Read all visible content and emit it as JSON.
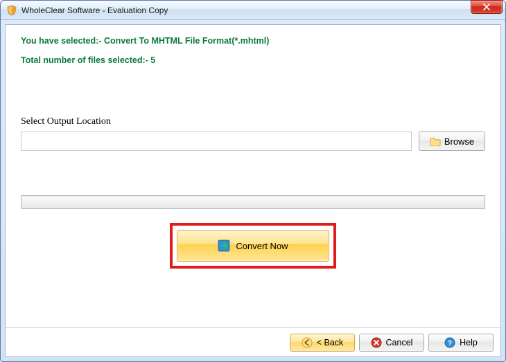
{
  "window": {
    "title": "WholeClear Software - Evaluation Copy"
  },
  "summary": {
    "selection_line": "You have selected:- Convert To MHTML File Format(*.mhtml)",
    "count_line": "Total number of files selected:- 5"
  },
  "output": {
    "label": "Select Output Location",
    "value": "",
    "browse_label": "Browse"
  },
  "actions": {
    "convert_label": "Convert Now"
  },
  "footer": {
    "back_label": "< Back",
    "cancel_label": "Cancel",
    "help_label": "Help"
  }
}
